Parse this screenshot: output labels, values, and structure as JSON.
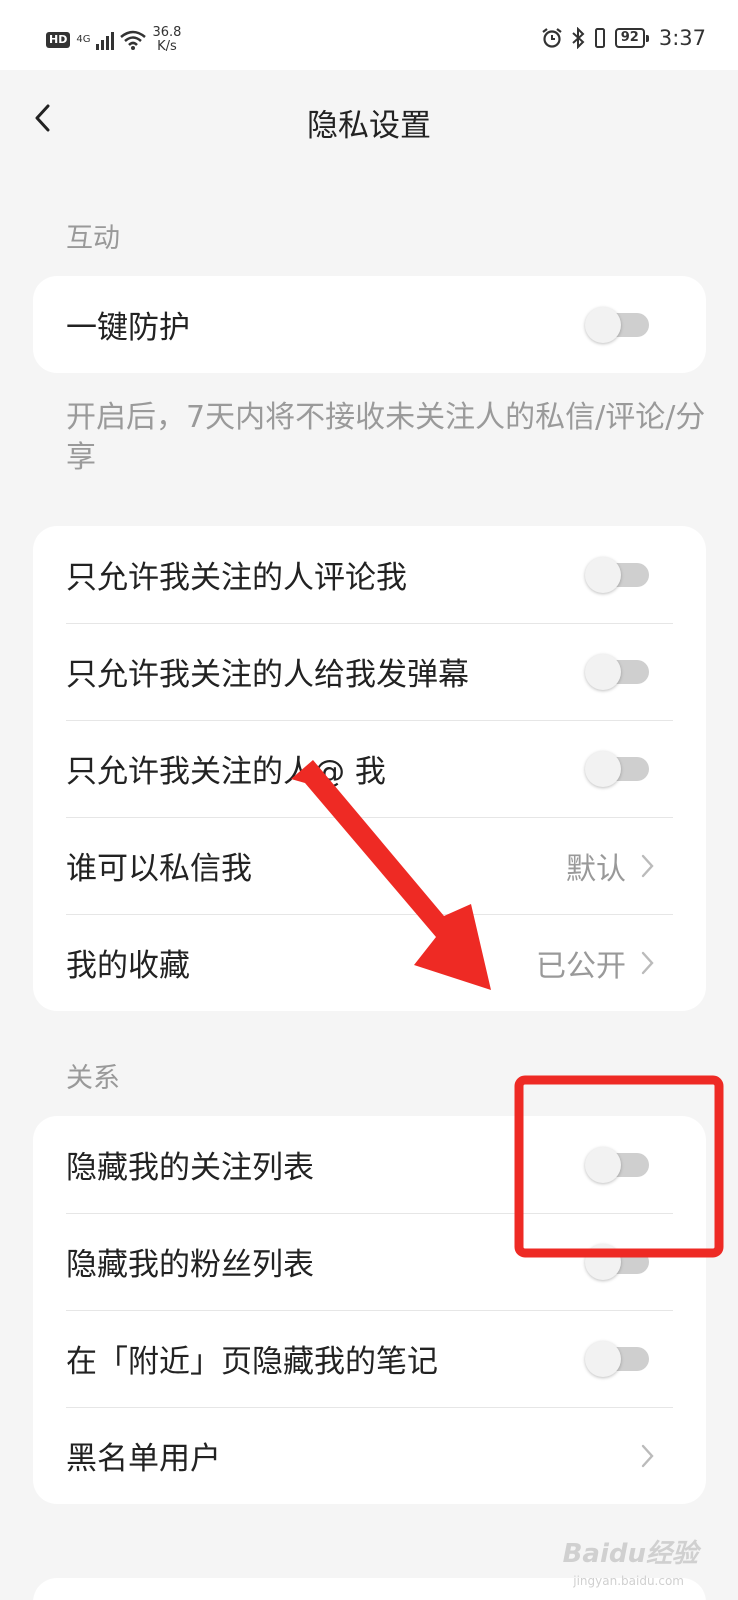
{
  "status_bar": {
    "hd": "HD",
    "network": "4G",
    "speed_value": "36.8",
    "speed_unit": "K/s",
    "battery": "92",
    "time": "3:37"
  },
  "header": {
    "title": "隐私设置"
  },
  "sections": {
    "interaction": {
      "label": "互动",
      "one_key": {
        "label": "一键防护",
        "toggle_on": false
      },
      "hint": "开启后，7天内将不接收未关注人的私信/评论/分享",
      "items": [
        {
          "label": "只允许我关注的人评论我",
          "type": "toggle",
          "on": false
        },
        {
          "label": "只允许我关注的人给我发弹幕",
          "type": "toggle",
          "on": false
        },
        {
          "label": "只允许我关注的人@ 我",
          "type": "toggle",
          "on": false
        },
        {
          "label": "谁可以私信我",
          "type": "link",
          "value": "默认"
        },
        {
          "label": "我的收藏",
          "type": "link",
          "value": "已公开"
        }
      ]
    },
    "relations": {
      "label": "关系",
      "items": [
        {
          "label": "隐藏我的关注列表",
          "type": "toggle",
          "on": false
        },
        {
          "label": "隐藏我的粉丝列表",
          "type": "toggle",
          "on": false
        },
        {
          "label": "在「附近」页隐藏我的笔记",
          "type": "toggle",
          "on": false
        },
        {
          "label": "黑名单用户",
          "type": "link",
          "value": ""
        }
      ]
    }
  },
  "annotation": {
    "color": "#ee2a24"
  },
  "watermark": {
    "text": "Baidu经验",
    "sub": "jingyan.baidu.com"
  },
  "colors": {
    "background": "#f5f5f5",
    "card": "#ffffff",
    "secondary_text": "#999999",
    "toggle_off_track": "#cfcfcf"
  }
}
